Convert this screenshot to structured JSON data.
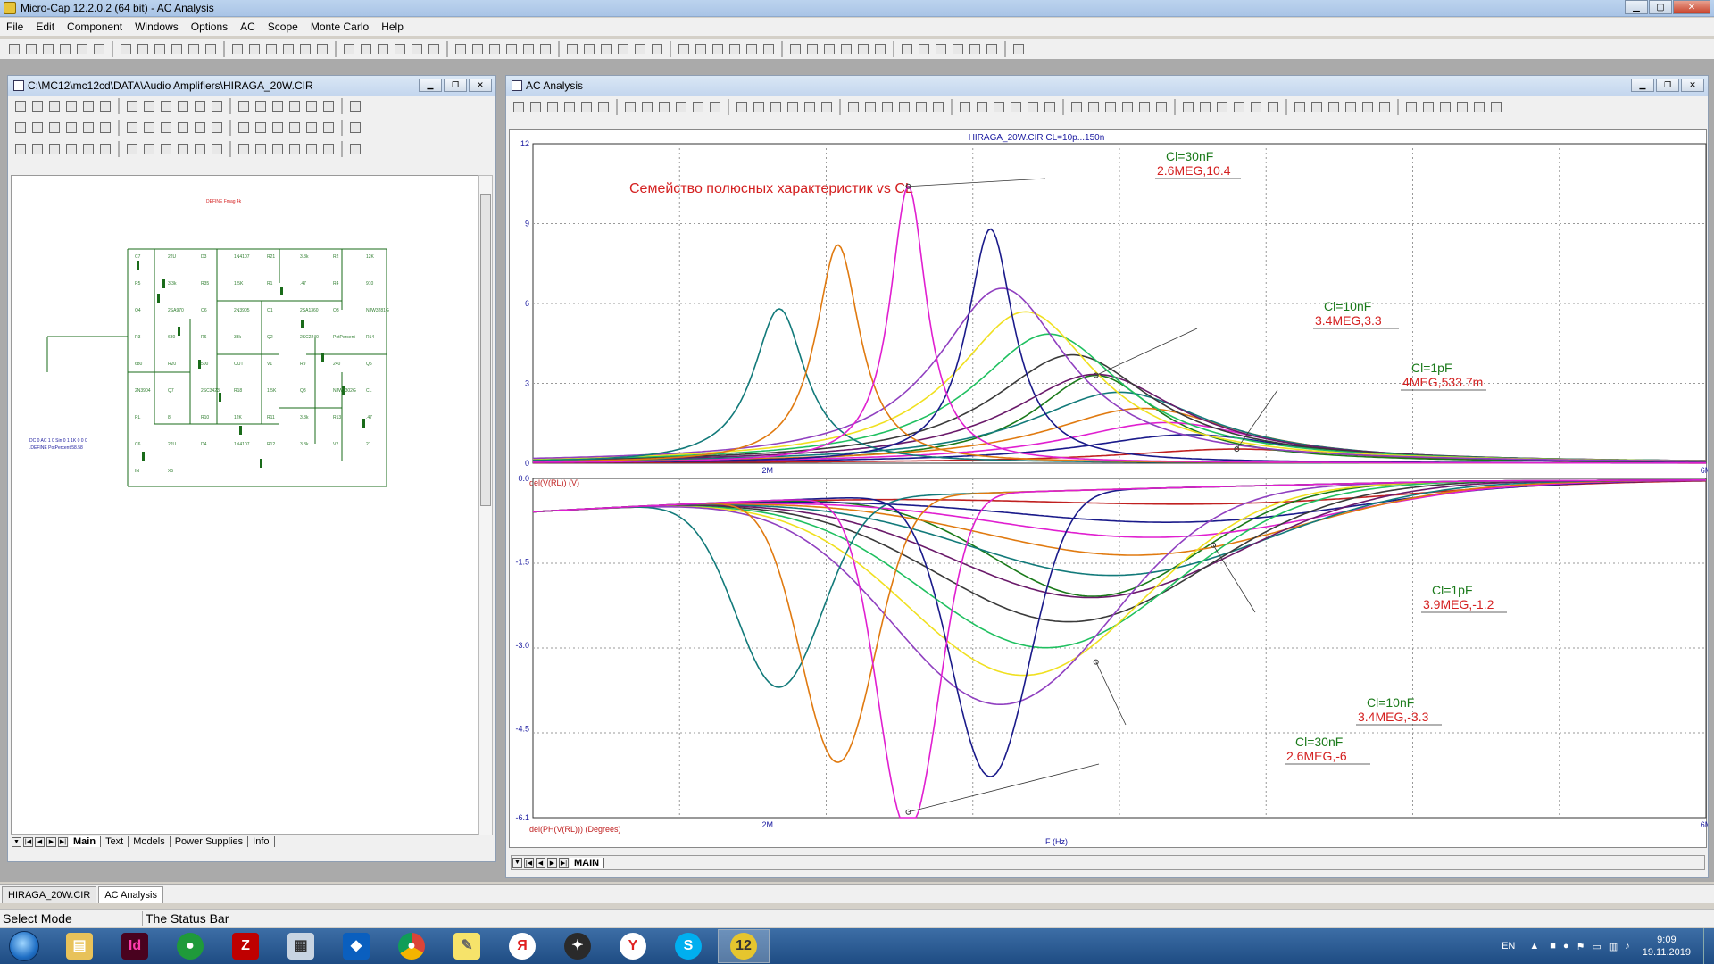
{
  "app": {
    "title": "Micro-Cap 12.2.0.2 (64 bit) - AC Analysis"
  },
  "menu": [
    "File",
    "Edit",
    "Component",
    "Windows",
    "Options",
    "AC",
    "Scope",
    "Monte Carlo",
    "Help"
  ],
  "schematic_window": {
    "title": "C:\\MC12\\mc12cd\\DATA\\Audio Amplifiers\\HIRAGA_20W.CIR",
    "tabs": [
      "Main",
      "Text",
      "Models",
      "Power Supplies",
      "Info"
    ],
    "active_tab": "Main",
    "header_text": "DEFINE Fmag 4k",
    "bottom_text_1": "DC 0 AC 1 0 Sin 0 1 1K 0 0 0",
    "bottom_text_2": ".DEFINE PotPercent 58.58",
    "components": [
      "C7",
      "22U",
      "D3",
      "1N4107",
      "R21",
      "3.3k",
      "R2",
      "12K",
      "R5",
      "3.3k",
      "R35",
      "1.5K",
      "R1",
      ".47",
      "R4",
      "910",
      "Q4",
      "2SA970",
      "Q6",
      "2N3905",
      "Q1",
      "2SA1360",
      "Q3",
      "NJW3281G",
      "R3",
      "680",
      "R6",
      "33k",
      "Q2",
      "2SC2240",
      "PotPercent",
      "R14",
      "680",
      "R20",
      "500",
      "OUT",
      "V1",
      "R9",
      "240",
      "Q5",
      "2N3904",
      "Q7",
      "2SC3423",
      "R18",
      "1.5K",
      "Q8",
      "NJW1302G",
      "CL",
      "RL",
      "8",
      "R10",
      "12K",
      "R11",
      "3.3k",
      "R13",
      ".47",
      "C6",
      "22U",
      "D4",
      "1N4107",
      "R12",
      "3.3k",
      "V2",
      "21",
      "IN",
      "X5"
    ]
  },
  "analysis_window": {
    "title": "AC Analysis",
    "tabs": [
      "MAIN"
    ],
    "plot_title": "HIRAGA_20W.CIR CL=10p...150n",
    "annotation_main": "Семейство полюсных характеристик vs CL",
    "x_axis_label": "F (Hz)",
    "top_ylabel": "del(V(RL)) (V)",
    "bottom_ylabel": "del(PH(V(RL))) (Degrees)",
    "top_labels": [
      {
        "name": "Cl=30nF",
        "value": "2.6MEG,10.4"
      },
      {
        "name": "Cl=10nF",
        "value": "3.4MEG,3.3"
      },
      {
        "name": "Cl=1pF",
        "value": "4MEG,533.7m"
      }
    ],
    "bottom_labels": [
      {
        "name": "Cl=1pF",
        "value": "3.9MEG,-1.2"
      },
      {
        "name": "Cl=10nF",
        "value": "3.4MEG,-3.3"
      },
      {
        "name": "Cl=30nF",
        "value": "2.6MEG,-6"
      }
    ]
  },
  "chart_data": [
    {
      "type": "line",
      "title": "HIRAGA_20W.CIR CL=10p...150n",
      "ylabel": "del(V(RL)) (V)",
      "xlim": [
        1000000,
        6000000
      ],
      "ylim": [
        0,
        12
      ],
      "xticks": [
        "2M",
        "6M"
      ],
      "yticks": [
        "0",
        "3",
        "6",
        "9",
        "12"
      ],
      "grid": true,
      "series": [
        {
          "name": "Cl=30nF",
          "peak_x": 2600000,
          "peak_y": 10.4,
          "color": "#e01fd0"
        },
        {
          "name": "Cl=10nF",
          "peak_x": 3400000,
          "peak_y": 3.3,
          "color": "#1a7a1a"
        },
        {
          "name": "Cl=1pF",
          "peak_x": 4000000,
          "peak_y": 0.5337,
          "color": "#c02020"
        }
      ]
    },
    {
      "type": "line",
      "ylabel": "del(PH(V(RL))) (Degrees)",
      "xlabel": "F (Hz)",
      "xlim": [
        1000000,
        6000000
      ],
      "ylim": [
        -6.1,
        0
      ],
      "xticks": [
        "2M",
        "6M"
      ],
      "yticks": [
        "0.0",
        "-1.5",
        "-3.0",
        "-4.5",
        "-6.1"
      ],
      "grid": true,
      "series": [
        {
          "name": "Cl=1pF",
          "trough_x": 3900000,
          "trough_y": -1.2,
          "color": "#c02020"
        },
        {
          "name": "Cl=10nF",
          "trough_x": 3400000,
          "trough_y": -3.3,
          "color": "#1a7a1a"
        },
        {
          "name": "Cl=30nF",
          "trough_x": 2600000,
          "trough_y": -6,
          "color": "#e01fd0"
        }
      ]
    }
  ],
  "doc_tabs": [
    "HIRAGA_20W.CIR",
    "AC Analysis"
  ],
  "status": {
    "mode": "Select Mode",
    "text": "The Status Bar"
  },
  "taskbar": {
    "lang": "EN",
    "time": "9:09",
    "date": "19.11.2019"
  }
}
